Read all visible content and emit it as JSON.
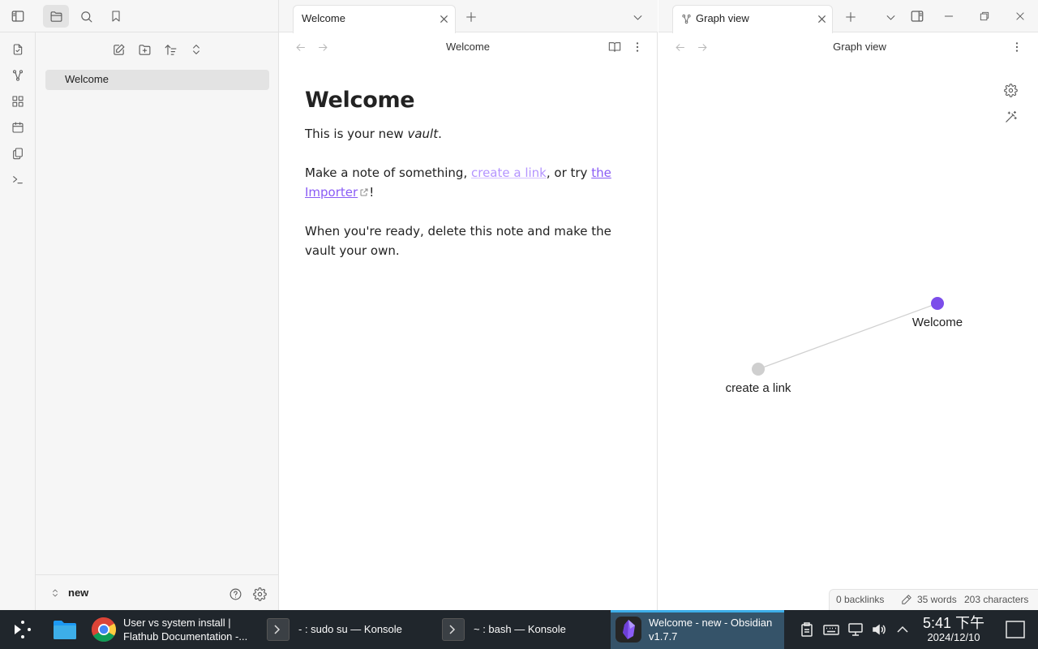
{
  "sidebar": {
    "tabs": [
      "files-icon",
      "search-icon",
      "bookmark-icon"
    ],
    "files": [
      {
        "name": "Welcome"
      }
    ],
    "vault_name": "new"
  },
  "editor": {
    "tab_title": "Welcome",
    "view_title": "Welcome",
    "note": {
      "heading": "Welcome",
      "p1_prefix": "This is your new ",
      "p1_em": "vault",
      "p1_suffix": ".",
      "p2_prefix": "Make a note of something, ",
      "p2_link1": "create a link",
      "p2_mid": ", or try ",
      "p2_link2": "the Importer",
      "p2_suffix": "!",
      "p3": "When you're ready, delete this note and make the vault your own."
    }
  },
  "graph": {
    "tab_title": "Graph view",
    "view_title": "Graph view",
    "nodes": [
      {
        "label": "Welcome",
        "color": "#7c4dea"
      },
      {
        "label": "create a link",
        "color": "#cfcfcf"
      }
    ],
    "status": {
      "backlinks": "0 backlinks",
      "words": "35 words",
      "characters": "203 characters"
    }
  },
  "taskbar": {
    "tasks": [
      {
        "line1": "User vs system install |",
        "line2": "Flathub Documentation -..."
      },
      {
        "line1": "- : sudo su — Konsole"
      },
      {
        "line1": "~ : bash — Konsole"
      },
      {
        "line1": "Welcome - new - Obsidian",
        "line2": "v1.7.7"
      }
    ],
    "clock_time": "5:41 下午",
    "clock_date": "2024/12/10"
  },
  "colors": {
    "accent": "#7c4dea",
    "link": "#a882ff",
    "taskbar_bg": "#20262c",
    "taskbar_active": "#355369"
  }
}
